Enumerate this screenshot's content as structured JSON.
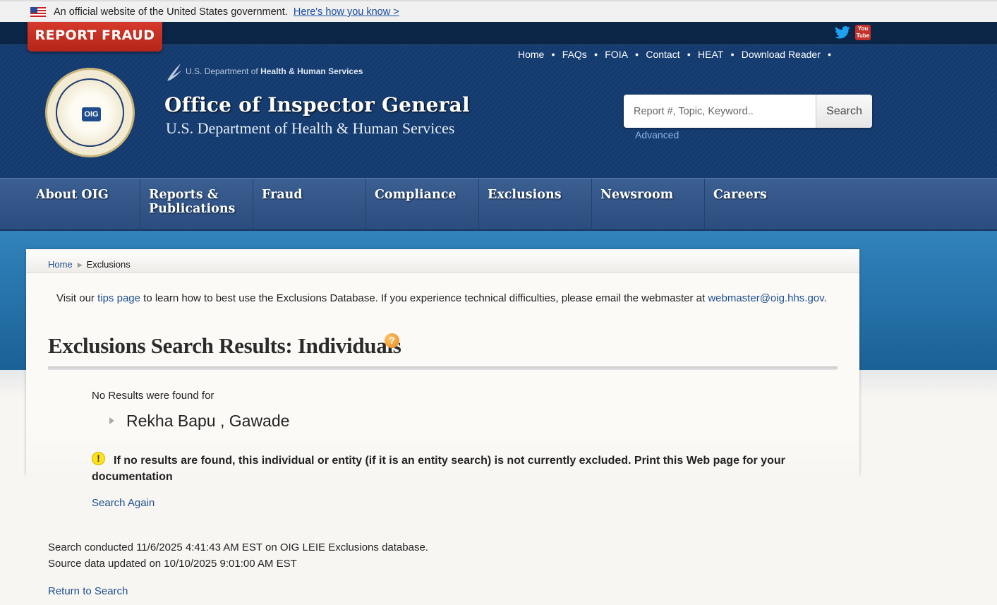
{
  "gov_banner": {
    "text": "An official website of the United States government.",
    "link": "Here's how you know >"
  },
  "header": {
    "report_fraud": "REPORT FRAUD",
    "top_nav": [
      "Home",
      "FAQs",
      "FOIA",
      "Contact",
      "HEAT",
      "Download Reader"
    ],
    "seal_label": "OIG",
    "hhs_prefix": "U.S. Department of",
    "hhs_bold": "Health & Human Services",
    "title": "Office of Inspector General",
    "subtitle": "U.S. Department of Health & Human Services",
    "search_placeholder": "Report #, Topic, Keyword..",
    "search_button": "Search",
    "advanced": "Advanced"
  },
  "main_nav": [
    "About OIG",
    "Reports & Publications",
    "Fraud",
    "Compliance",
    "Exclusions",
    "Newsroom",
    "Careers"
  ],
  "breadcrumb": {
    "home": "Home",
    "current": "Exclusions"
  },
  "intro": {
    "before": "Visit our ",
    "tips_link": "tips page",
    "middle": " to learn how to best use the Exclusions Database. If you experience technical difficulties, please email the webmaster at ",
    "email": "webmaster@oig.hhs.gov",
    "after": "."
  },
  "results": {
    "title": "Exclusions Search Results: Individuals",
    "help_glyph": "?",
    "no_results": "No Results were found for",
    "name": "Rekha Bapu , Gawade",
    "warning_glyph": "!",
    "warning": "If no results are found, this individual or entity (if it is an entity search) is not currently excluded. Print this Web page for your documentation",
    "search_again": "Search Again"
  },
  "footer_meta": {
    "conducted": "Search conducted 11/6/2025 4:41:43 AM EST on OIG LEIE Exclusions database.",
    "updated": "Source data updated on 10/10/2025 9:01:00 AM EST",
    "return": "Return to Search"
  },
  "colors": {
    "header_blue": "#173f74",
    "topbar": "#0b2546",
    "report_red": "#c42e20",
    "link_blue": "#1d4f91",
    "band_blue": "#2a77b0"
  }
}
